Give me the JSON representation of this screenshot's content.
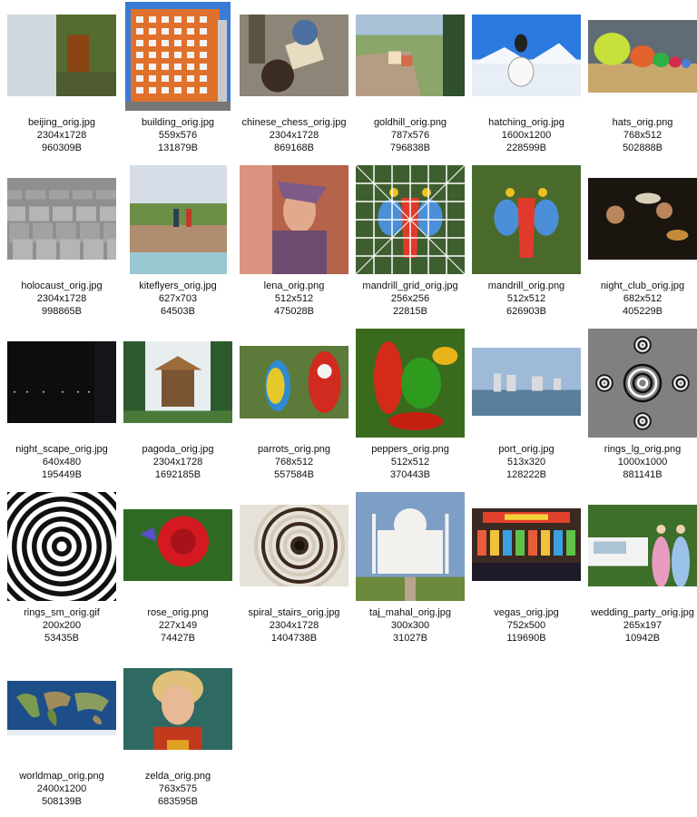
{
  "images": [
    {
      "name": "beijing_orig.jpg",
      "size": "2304x1728",
      "bytes": "960309B",
      "icon": "landscape-photo"
    },
    {
      "name": "building_orig.jpg",
      "size": "559x576",
      "bytes": "131879B",
      "icon": "building-photo"
    },
    {
      "name": "chinese_chess_orig.jpg",
      "size": "2304x1728",
      "bytes": "869168B",
      "icon": "chess-players-photo"
    },
    {
      "name": "goldhill_orig.png",
      "size": "787x576",
      "bytes": "796838B",
      "icon": "village-street-photo"
    },
    {
      "name": "hatching_orig.jpg",
      "size": "1600x1200",
      "bytes": "228599B",
      "icon": "hatching-egg-render"
    },
    {
      "name": "hats_orig.png",
      "size": "768x512",
      "bytes": "502888B",
      "icon": "colored-hats-render"
    },
    {
      "name": "holocaust_orig.jpg",
      "size": "2304x1728",
      "bytes": "998865B",
      "icon": "concrete-blocks-photo"
    },
    {
      "name": "kiteflyers_orig.jpg",
      "size": "627x703",
      "bytes": "64503B",
      "icon": "kite-flyers-photo"
    },
    {
      "name": "lena_orig.png",
      "size": "512x512",
      "bytes": "475028B",
      "icon": "portrait-photo"
    },
    {
      "name": "mandrill_grid_orig.jpg",
      "size": "256x256",
      "bytes": "22815B",
      "icon": "mandrill-grid-photo"
    },
    {
      "name": "mandrill_orig.png",
      "size": "512x512",
      "bytes": "626903B",
      "icon": "mandrill-photo"
    },
    {
      "name": "night_club_orig.jpg",
      "size": "682x512",
      "bytes": "405229B",
      "icon": "band-photo"
    },
    {
      "name": "night_scape_orig.jpg",
      "size": "640x480",
      "bytes": "195449B",
      "icon": "night-city-photo"
    },
    {
      "name": "pagoda_orig.jpg",
      "size": "2304x1728",
      "bytes": "1692185B",
      "icon": "pagoda-photo"
    },
    {
      "name": "parrots_orig.png",
      "size": "768x512",
      "bytes": "557584B",
      "icon": "parrots-photo"
    },
    {
      "name": "peppers_orig.png",
      "size": "512x512",
      "bytes": "370443B",
      "icon": "peppers-photo"
    },
    {
      "name": "port_orig.jpg",
      "size": "513x320",
      "bytes": "128222B",
      "icon": "harbor-photo"
    },
    {
      "name": "rings_lg_orig.png",
      "size": "1000x1000",
      "bytes": "881141B",
      "icon": "rings-pattern"
    },
    {
      "name": "rings_sm_orig.gif",
      "size": "200x200",
      "bytes": "53435B",
      "icon": "concentric-rings-pattern"
    },
    {
      "name": "rose_orig.png",
      "size": "227x149",
      "bytes": "74427B",
      "icon": "rose-photo"
    },
    {
      "name": "spiral_stairs_orig.jpg",
      "size": "2304x1728",
      "bytes": "1404738B",
      "icon": "spiral-stairs-photo"
    },
    {
      "name": "taj_mahal_orig.jpg",
      "size": "300x300",
      "bytes": "31027B",
      "icon": "taj-mahal-photo"
    },
    {
      "name": "vegas_orig.jpg",
      "size": "752x500",
      "bytes": "119690B",
      "icon": "market-stall-photo"
    },
    {
      "name": "wedding_party_orig.jpg",
      "size": "265x197",
      "bytes": "10942B",
      "icon": "wedding-party-photo"
    },
    {
      "name": "worldmap_orig.png",
      "size": "2400x1200",
      "bytes": "508139B",
      "icon": "world-map"
    },
    {
      "name": "zelda_orig.png",
      "size": "763x575",
      "bytes": "683595B",
      "icon": "portrait-photo"
    }
  ]
}
